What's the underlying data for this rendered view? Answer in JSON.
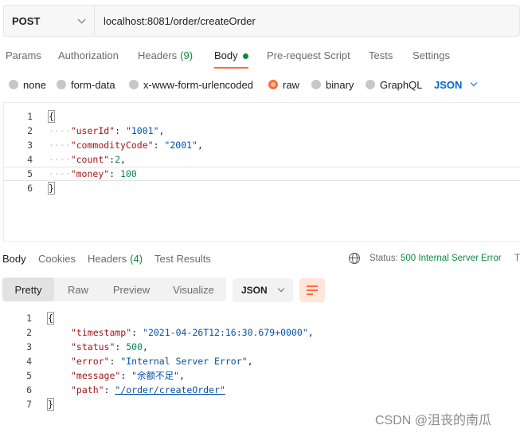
{
  "request": {
    "method": "POST",
    "url": "localhost:8081/order/createOrder"
  },
  "request_tabs": {
    "params": "Params",
    "authorization": "Authorization",
    "headers": "Headers",
    "headers_count": "(9)",
    "body": "Body",
    "prerequest": "Pre-request Script",
    "tests": "Tests",
    "settings": "Settings"
  },
  "body_options": {
    "none": "none",
    "form_data": "form-data",
    "urlencoded": "x-www-form-urlencoded",
    "raw": "raw",
    "binary": "binary",
    "graphql": "GraphQL",
    "language": "JSON"
  },
  "request_body": {
    "line_numbers": [
      "1",
      "2",
      "3",
      "4",
      "5",
      "6"
    ],
    "open_brace": "{",
    "close_brace": "}",
    "fields": [
      {
        "key": "\"userId\"",
        "value": "\"1001\"",
        "trail": ","
      },
      {
        "key": "\"commodityCode\"",
        "value": "\"2001\"",
        "trail": ","
      },
      {
        "key": "\"count\"",
        "value": "2",
        "trail": ","
      },
      {
        "key": "\"money\"",
        "value": "100",
        "trail": ""
      }
    ]
  },
  "response_tabs": {
    "body": "Body",
    "cookies": "Cookies",
    "headers": "Headers",
    "headers_count": "(4)",
    "test_results": "Test Results",
    "status_label": "Status:",
    "status_value": "500 Internal Server Error",
    "status_trunc": "T"
  },
  "response_toolbar": {
    "pretty": "Pretty",
    "raw": "Raw",
    "preview": "Preview",
    "visualize": "Visualize",
    "format": "JSON"
  },
  "response_body": {
    "line_numbers": [
      "1",
      "2",
      "3",
      "4",
      "5",
      "6",
      "7"
    ],
    "open_brace": "{",
    "close_brace": "}",
    "fields": [
      {
        "key": "\"timestamp\"",
        "value": "\"2021-04-26T12:16:30.679+0000\"",
        "trail": ","
      },
      {
        "key": "\"status\"",
        "value": "500",
        "trail": ","
      },
      {
        "key": "\"error\"",
        "value": "\"Internal Server Error\"",
        "trail": ","
      },
      {
        "key": "\"message\"",
        "value": "\"余额不足\"",
        "trail": ","
      },
      {
        "key": "\"path\"",
        "value": "\"/order/createOrder\"",
        "trail": ""
      }
    ]
  },
  "watermark": "CSDN @沮丧的南瓜",
  "colors": {
    "accent": "#ff6c37",
    "success": "#0b8a3e",
    "link": "#0265d2"
  }
}
